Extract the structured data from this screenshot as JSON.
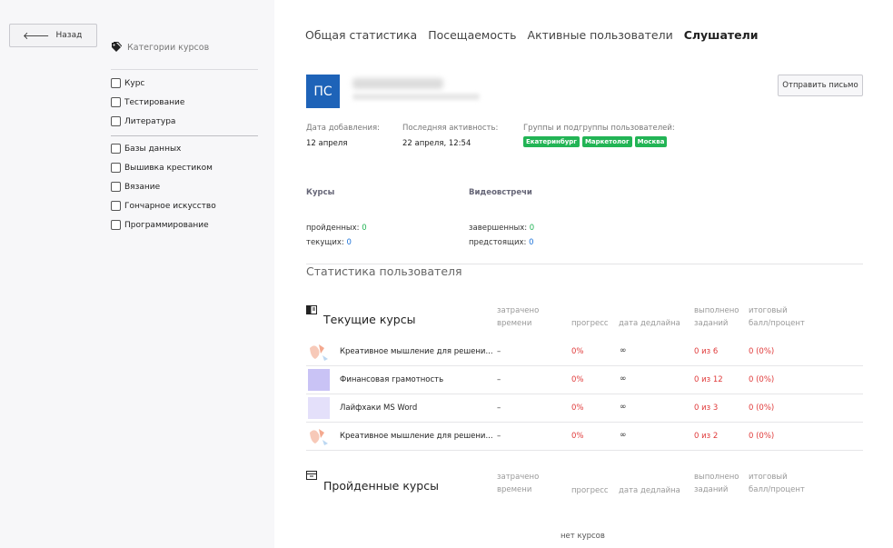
{
  "sidebar": {
    "back_label": "Назад",
    "categories_title": "Категории курсов",
    "group1": [
      "Курс",
      "Тестирование",
      "Литература"
    ],
    "group2": [
      "Базы данных",
      "Вышивка крестиком",
      "Вязание",
      "Гончарное искусство",
      "Программирование"
    ]
  },
  "tabs": [
    "Общая статистика",
    "Посещаемость",
    "Активные пользователи",
    "Слушатели"
  ],
  "active_tab": "Слушатели",
  "user": {
    "initials": "ПС",
    "send_button": "Отправить письмо",
    "added_label": "Дата добавления:",
    "added_value": "12 апреля",
    "activity_label": "Последняя активность:",
    "activity_value": "22 апреля, 12:54",
    "groups_label": "Группы и подгруппы пользователей:",
    "groups": [
      "Екатеринбург",
      "Маркетолог",
      "Москва"
    ]
  },
  "courses": {
    "title": "Курсы",
    "passed_label": "пройденных:",
    "passed_value": "0",
    "current_label": "текущих:",
    "current_value": "0"
  },
  "meetings": {
    "title": "Видеовстречи",
    "completed_label": "завершенных:",
    "completed_value": "0",
    "upcoming_label": "предстоящих:",
    "upcoming_value": "0"
  },
  "stats_title": "Статистика пользователя",
  "columns": {
    "time": [
      "затрачено",
      "времени"
    ],
    "progress": "прогресс",
    "deadline": "дата дедлайна",
    "tasks": [
      "выполнено",
      "заданий"
    ],
    "score": [
      "итоговый",
      "балл/процент"
    ]
  },
  "current_title": "Текущие курсы",
  "current_rows": [
    {
      "name": "Креативное мышление для решени...",
      "time": "–",
      "progress": "0%",
      "deadline": "∞",
      "tasks": "0 из 6",
      "score": "0 (0%)",
      "thumb": "illustration"
    },
    {
      "name": "Финансовая грамотность",
      "time": "–",
      "progress": "0%",
      "deadline": "∞",
      "tasks": "0 из 12",
      "score": "0 (0%)",
      "thumb": "purple"
    },
    {
      "name": "Лайфхаки MS Word",
      "time": "–",
      "progress": "0%",
      "deadline": "∞",
      "tasks": "0 из 3",
      "score": "0 (0%)",
      "thumb": "lavender"
    },
    {
      "name": "Креативное мышление для решени...",
      "time": "–",
      "progress": "0%",
      "deadline": "∞",
      "tasks": "0 из 2",
      "score": "0 (0%)",
      "thumb": "illustration"
    }
  ],
  "passed_title": "Пройденные курсы",
  "no_courses": "нет курсов",
  "colors": {
    "green": "#22b455",
    "red": "#e03a3a",
    "blue": "#1e73d8",
    "avatar": "#1e63b8"
  }
}
